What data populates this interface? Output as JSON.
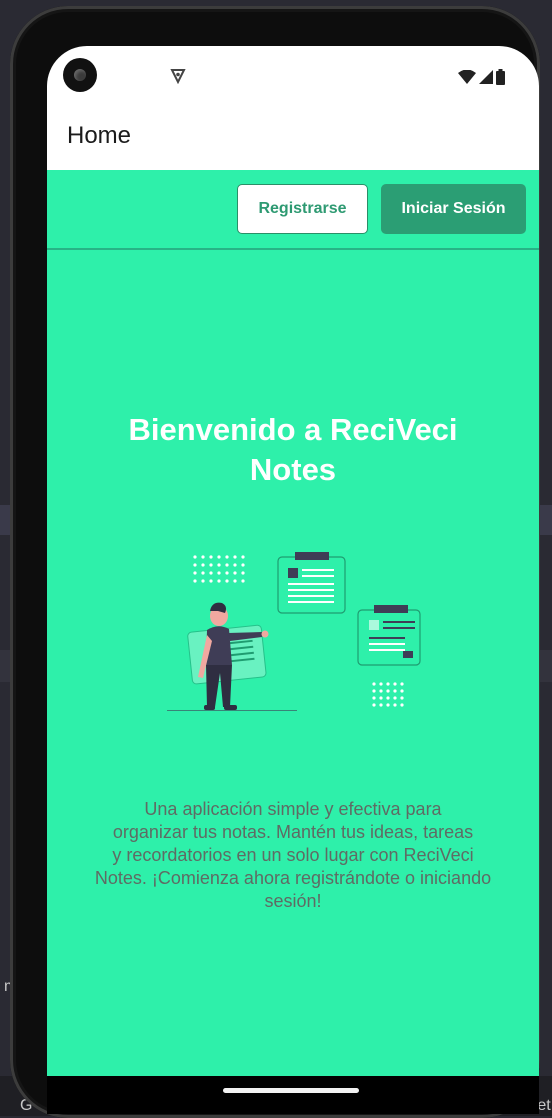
{
  "desktop": {
    "fragment_left": "G",
    "fragment_right": "ret",
    "fragment_mid": "m"
  },
  "status_bar": {
    "icons": [
      "camera-hole",
      "shield-icon",
      "wifi-icon",
      "signal-icon",
      "battery-icon"
    ]
  },
  "app_bar": {
    "title": "Home"
  },
  "header_buttons": {
    "register_label": "Registrarse",
    "login_label": "Iniciar Sesión"
  },
  "welcome": {
    "line1": "Bienvenido a ReciVeci",
    "line2": "Notes"
  },
  "description": {
    "line1": "Una aplicación simple y efectiva para",
    "line2": "organizar tus notas. Mantén tus ideas, tareas",
    "line3": "y recordatorios en un solo lugar con ReciVeci",
    "line4": "Notes. ¡Comienza ahora registrándote o iniciando",
    "line5": "sesión!"
  },
  "colors": {
    "background": "#2ef0aa",
    "primary_button": "#2b9e74",
    "text_white": "#ffffff",
    "description_text": "#5f6b64"
  },
  "illustration": "person-with-notes-illustration"
}
